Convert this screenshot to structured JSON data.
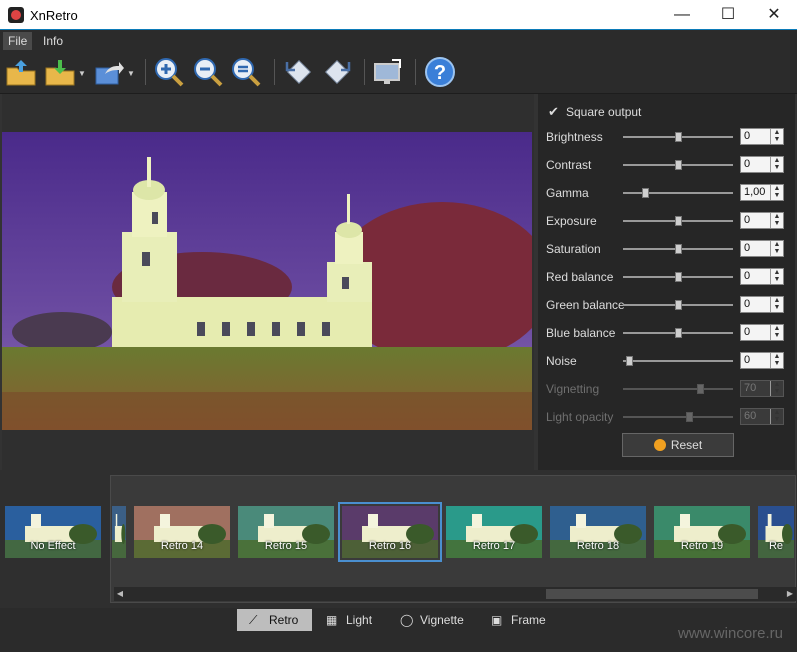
{
  "window": {
    "title": "XnRetro",
    "minimize": "—",
    "maximize": "☐",
    "close": "✕"
  },
  "menu": [
    {
      "label": "File"
    },
    {
      "label": "Info"
    }
  ],
  "toolbar": {
    "buttons": [
      "open-icon",
      "save-icon",
      "share-icon",
      "zoom-in-icon",
      "zoom-out-icon",
      "zoom-fit-icon",
      "rotate-left-icon",
      "rotate-right-icon",
      "fullscreen-icon",
      "help-icon"
    ]
  },
  "panel": {
    "square_output": {
      "label": "Square output",
      "checked": true
    },
    "sliders": [
      {
        "label": "Brightness",
        "value": "0",
        "level": 0.5,
        "enabled": true
      },
      {
        "label": "Contrast",
        "value": "0",
        "level": 0.5,
        "enabled": true
      },
      {
        "label": "Gamma",
        "value": "1,00",
        "level": 0.2,
        "enabled": true
      },
      {
        "label": "Exposure",
        "value": "0",
        "level": 0.5,
        "enabled": true
      },
      {
        "label": "Saturation",
        "value": "0",
        "level": 0.5,
        "enabled": true
      },
      {
        "label": "Red balance",
        "value": "0",
        "level": 0.5,
        "enabled": true
      },
      {
        "label": "Green balance",
        "value": "0",
        "level": 0.5,
        "enabled": true
      },
      {
        "label": "Blue balance",
        "value": "0",
        "level": 0.5,
        "enabled": true
      },
      {
        "label": "Noise",
        "value": "0",
        "level": 0.05,
        "enabled": true
      },
      {
        "label": "Vignetting",
        "value": "70",
        "level": 0.7,
        "enabled": false
      },
      {
        "label": "Light opacity",
        "value": "60",
        "level": 0.6,
        "enabled": false
      }
    ],
    "reset_label": "Reset"
  },
  "presets": [
    {
      "label": "No Effect",
      "tint": "#2a5f9e",
      "selected": false
    },
    {
      "label": "",
      "tint": "#3b5f86",
      "selected": false
    },
    {
      "label": "Retro 14",
      "tint": "#a07060",
      "selected": false
    },
    {
      "label": "Retro 15",
      "tint": "#4a8a7a",
      "selected": false
    },
    {
      "label": "Retro 16",
      "tint": "#5a3b6a",
      "selected": true
    },
    {
      "label": "Retro 17",
      "tint": "#2a9a8a",
      "selected": false
    },
    {
      "label": "Retro 18",
      "tint": "#2f5f8f",
      "selected": false
    },
    {
      "label": "Retro 19",
      "tint": "#3a8a6a",
      "selected": false
    },
    {
      "label": "Re",
      "tint": "#2a4f8f",
      "selected": false
    }
  ],
  "tabs": [
    {
      "label": "Retro",
      "active": true,
      "icon": "wand-icon"
    },
    {
      "label": "Light",
      "active": false,
      "icon": "grid-icon"
    },
    {
      "label": "Vignette",
      "active": false,
      "icon": "vignette-icon"
    },
    {
      "label": "Frame",
      "active": false,
      "icon": "frame-icon"
    }
  ],
  "watermark": "www.wincore.ru"
}
